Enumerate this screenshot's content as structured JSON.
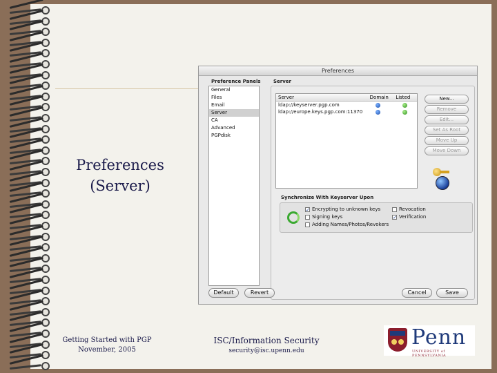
{
  "slide": {
    "title_line1": "Preferences",
    "title_line2": "(Server)",
    "footer_left_line1": "Getting Started with PGP",
    "footer_left_line2": "November, 2005",
    "footer_center_title": "ISC/Information Security",
    "footer_center_email": "security@isc.upenn.edu"
  },
  "logo": {
    "word": "Penn",
    "subtitle": "UNIVERSITY of PENNSYLVANIA",
    "shield_color": "#8b1d2c",
    "brand_color": "#1f3a7a"
  },
  "window": {
    "title": "Preferences",
    "panels_header": "Preference Panels",
    "server_header": "Server",
    "panels": [
      "General",
      "Files",
      "Email",
      "Server",
      "CA",
      "Advanced",
      "PGPdisk"
    ],
    "selected_panel": "Server",
    "table": {
      "columns": [
        "Server",
        "Domain",
        "Listed"
      ],
      "rows": [
        {
          "server": "ldap://keyserver.pgp.com"
        },
        {
          "server": "ldap://europe.keys.pgp.com:11370"
        }
      ]
    },
    "buttons": {
      "new": "New...",
      "remove": "Remove",
      "edit": "Edit...",
      "set_as_root": "Set As Root",
      "move_up": "Move Up",
      "move_down": "Move Down",
      "default": "Default",
      "revert": "Revert",
      "cancel": "Cancel",
      "save": "Save"
    },
    "sync": {
      "label": "Synchronize With Keyserver Upon",
      "options": [
        {
          "label": "Encrypting to unknown keys",
          "checked": true
        },
        {
          "label": "Signing keys",
          "checked": false
        },
        {
          "label": "Adding Names/Photos/Revokers",
          "checked": false
        },
        {
          "label": "Revocation",
          "checked": false
        },
        {
          "label": "Verification",
          "checked": true
        }
      ]
    }
  }
}
